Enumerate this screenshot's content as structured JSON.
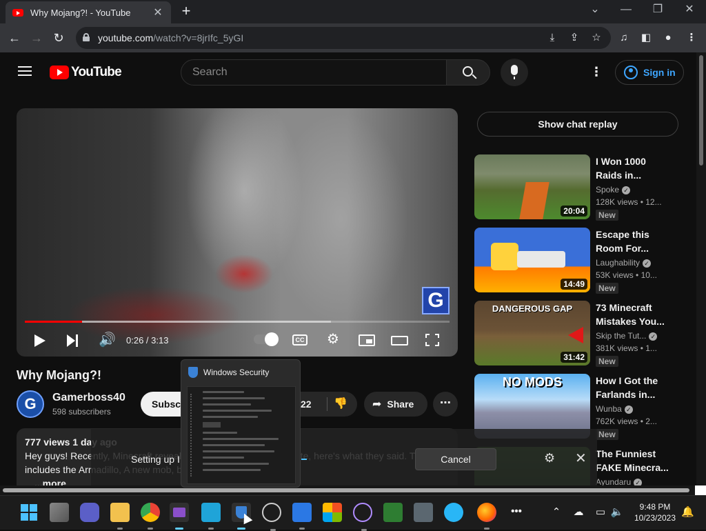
{
  "browser": {
    "tab_title": "Why Mojang?! - YouTube",
    "tab_close": "✕",
    "new_tab": "+",
    "url_domain": "youtube.com",
    "url_path": "/watch?v=8jrIfc_5yGI",
    "window_controls": {
      "minimize": "—",
      "restore": "❐",
      "close": "✕",
      "tab_search": "⌄"
    }
  },
  "youtube": {
    "logo_text": "YouTube",
    "search_placeholder": "Search",
    "sign_in": "Sign in",
    "menu_dots": "⋮",
    "show_chat_replay": "Show chat replay"
  },
  "player": {
    "time": "0:26 / 3:13",
    "progress_played": 0.134,
    "progress_buffered": 0.72,
    "cc_label": "CC",
    "badge_letter": "G",
    "volume_icon": "🔊",
    "settings_icon": "⚙"
  },
  "video": {
    "title": "Why Mojang?!",
    "channel_name": "Gamerboss40",
    "subscribers": "598 subscribers",
    "subscribe_label": "Subscribe",
    "like_count": "22",
    "share_label": "Share",
    "more_actions": "⋯",
    "avatar_letter": "G",
    "description_meta": "777 views  1 day ago",
    "description_line1": "Hey guys! Recently, Minecraft revealed the winner of the mob vote, here's what they said. This",
    "description_line2": "includes the Armadillo, A new mob, b...",
    "description_more": "...more"
  },
  "recommendations": [
    {
      "title": "I Won 1000 Raids in...",
      "channel": "Spoke",
      "views": "128K views",
      "age": "12...",
      "duration": "20:04",
      "badge": "New",
      "verified": true
    },
    {
      "title": "Escape this Room For...",
      "channel": "Laughability",
      "views": "53K views",
      "age": "10...",
      "duration": "14:49",
      "badge": "New",
      "verified": true
    },
    {
      "title": "73 Minecraft Mistakes You...",
      "channel": "Skip the Tut...",
      "views": "381K views",
      "age": "1...",
      "duration": "31:42",
      "badge": "New",
      "verified": true,
      "thumb_text": "DANGEROUS GAP"
    },
    {
      "title": "How I Got the Farlands in...",
      "channel": "Wunba",
      "views": "762K views",
      "age": "2...",
      "duration": "",
      "badge": "New",
      "verified": true,
      "thumb_text": "NO MODS"
    },
    {
      "title": "The Funniest FAKE Minecra...",
      "channel": "Ayundaru",
      "views": "",
      "age": "",
      "duration": "",
      "badge": "",
      "verified": true
    }
  ],
  "toast": {
    "message": "Setting up I",
    "cancel": "Cancel",
    "settings_icon": "⚙",
    "close_icon": "✕"
  },
  "security_preview": {
    "title": "Windows Security"
  },
  "taskbar": {
    "time": "9:48 PM",
    "date": "10/23/2023",
    "overflow": "•••",
    "chevron": "⌃"
  },
  "colors": {
    "yt_red": "#ff0000",
    "link_blue": "#3ea6ff",
    "win_accent": "#60cdff"
  }
}
